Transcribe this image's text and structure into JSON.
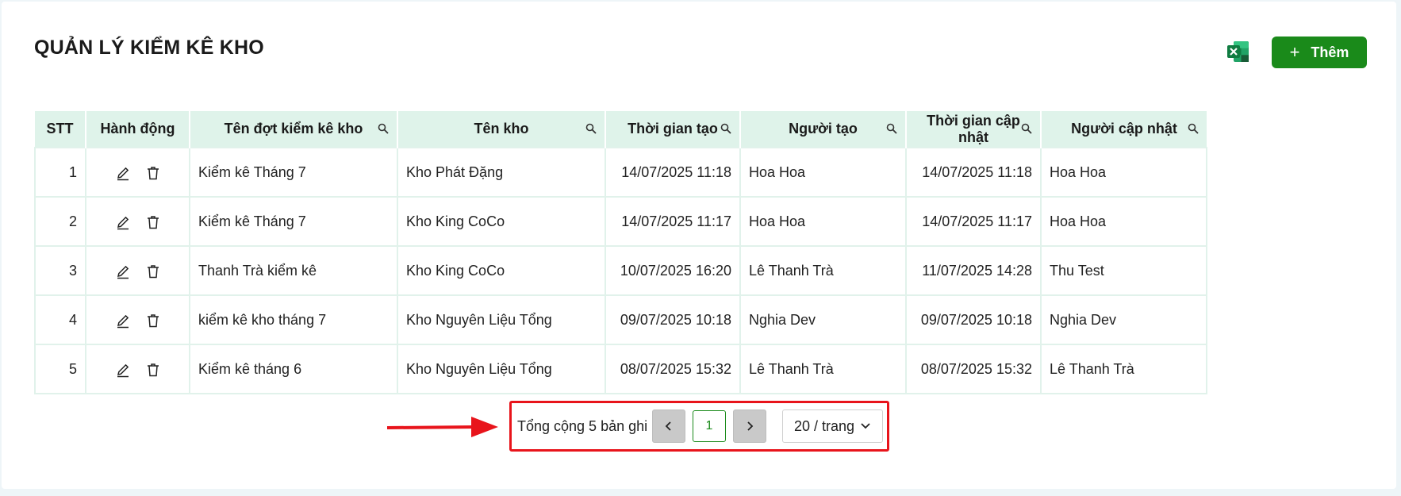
{
  "page": {
    "title": "QUẢN LÝ KIỂM KÊ KHO"
  },
  "toolbar": {
    "excel_icon": "excel-icon",
    "add_label": "Thêm",
    "add_icon": "plus-icon",
    "accent_color": "#1a8a1a"
  },
  "table": {
    "headers": [
      "STT",
      "Hành động",
      "Tên đợt kiểm kê kho",
      "Tên kho",
      "Thời gian tạo",
      "Người tạo",
      "Thời gian cập nhật",
      "Người cập nhật"
    ],
    "searchable_columns": [
      2,
      3,
      4,
      5,
      6,
      7
    ],
    "header_bg": "#dff3ea",
    "rows": [
      {
        "stt": "1",
        "name": "Kiểm kê Tháng 7",
        "warehouse": "Kho Phát Đặng",
        "created_at": "14/07/2025 11:18",
        "created_by": "Hoa Hoa",
        "updated_at": "14/07/2025 11:18",
        "updated_by": "Hoa Hoa"
      },
      {
        "stt": "2",
        "name": "Kiểm kê Tháng 7",
        "warehouse": "Kho King CoCo",
        "created_at": "14/07/2025 11:17",
        "created_by": "Hoa Hoa",
        "updated_at": "14/07/2025 11:17",
        "updated_by": "Hoa Hoa"
      },
      {
        "stt": "3",
        "name": "Thanh Trà kiểm kê",
        "warehouse": "Kho King CoCo",
        "created_at": "10/07/2025 16:20",
        "created_by": "Lê Thanh Trà",
        "updated_at": "11/07/2025 14:28",
        "updated_by": "Thu Test"
      },
      {
        "stt": "4",
        "name": "kiểm kê kho tháng 7",
        "warehouse": "Kho Nguyên Liệu Tổng",
        "created_at": "09/07/2025 10:18",
        "created_by": "Nghia Dev",
        "updated_at": "09/07/2025 10:18",
        "updated_by": "Nghia Dev"
      },
      {
        "stt": "5",
        "name": "Kiểm kê tháng 6",
        "warehouse": "Kho Nguyên Liệu Tổng",
        "created_at": "08/07/2025 15:32",
        "created_by": "Lê Thanh Trà",
        "updated_at": "08/07/2025 15:32",
        "updated_by": "Lê Thanh Trà"
      }
    ]
  },
  "pagination": {
    "total_text": "Tổng cộng 5 bản ghi",
    "current_page": "1",
    "page_size": "20 / trang",
    "highlight_color": "#e8141b"
  }
}
